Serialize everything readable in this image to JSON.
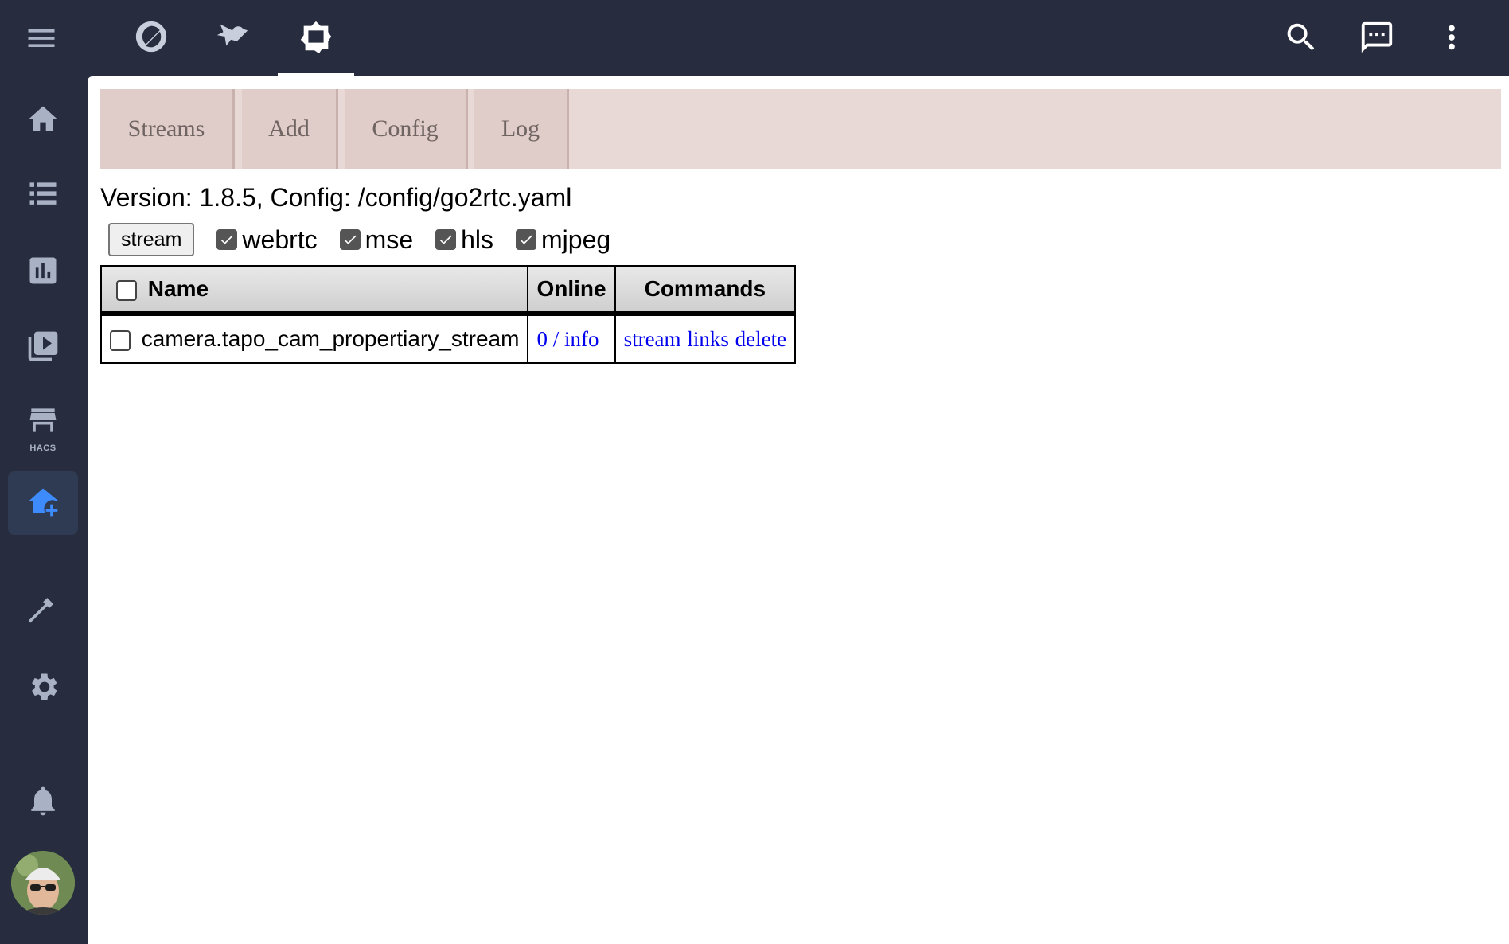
{
  "top_tabs": [
    {
      "name": "zwave-icon",
      "active": false
    },
    {
      "name": "bird-icon",
      "active": false
    },
    {
      "name": "go2rtc-icon",
      "active": true
    }
  ],
  "top_actions": [
    "search-icon",
    "assist-chat-icon",
    "more-vert-icon"
  ],
  "sidebar": {
    "items": [
      {
        "icon": "home-icon"
      },
      {
        "icon": "list-icon"
      },
      {
        "icon": "chart-icon"
      },
      {
        "icon": "media-icon"
      },
      {
        "icon": "hacs-store-icon",
        "label": "HACS"
      },
      {
        "icon": "home-plus-icon",
        "active": true
      },
      {
        "icon": "hammer-icon"
      },
      {
        "icon": "gear-icon"
      },
      {
        "icon": "bell-icon"
      }
    ]
  },
  "nav": {
    "tabs": [
      "Streams",
      "Add",
      "Config",
      "Log"
    ]
  },
  "version_line": "Version: 1.8.5, Config: /config/go2rtc.yaml",
  "controls": {
    "stream_button": "stream",
    "modes": [
      {
        "label": "webrtc",
        "checked": true
      },
      {
        "label": "mse",
        "checked": true
      },
      {
        "label": "hls",
        "checked": true
      },
      {
        "label": "mjpeg",
        "checked": true
      }
    ]
  },
  "table": {
    "headers": [
      "Name",
      "Online",
      "Commands"
    ],
    "rows": [
      {
        "name": "camera.tapo_cam_propertiary_stream",
        "online": "0 / info",
        "commands": [
          "stream",
          "links",
          "delete"
        ]
      }
    ]
  },
  "colors": {
    "chrome": "#272d3e",
    "active_accent": "#3d8bfd",
    "nav_bar": "#e8d9d6",
    "link": "#0000ee"
  }
}
